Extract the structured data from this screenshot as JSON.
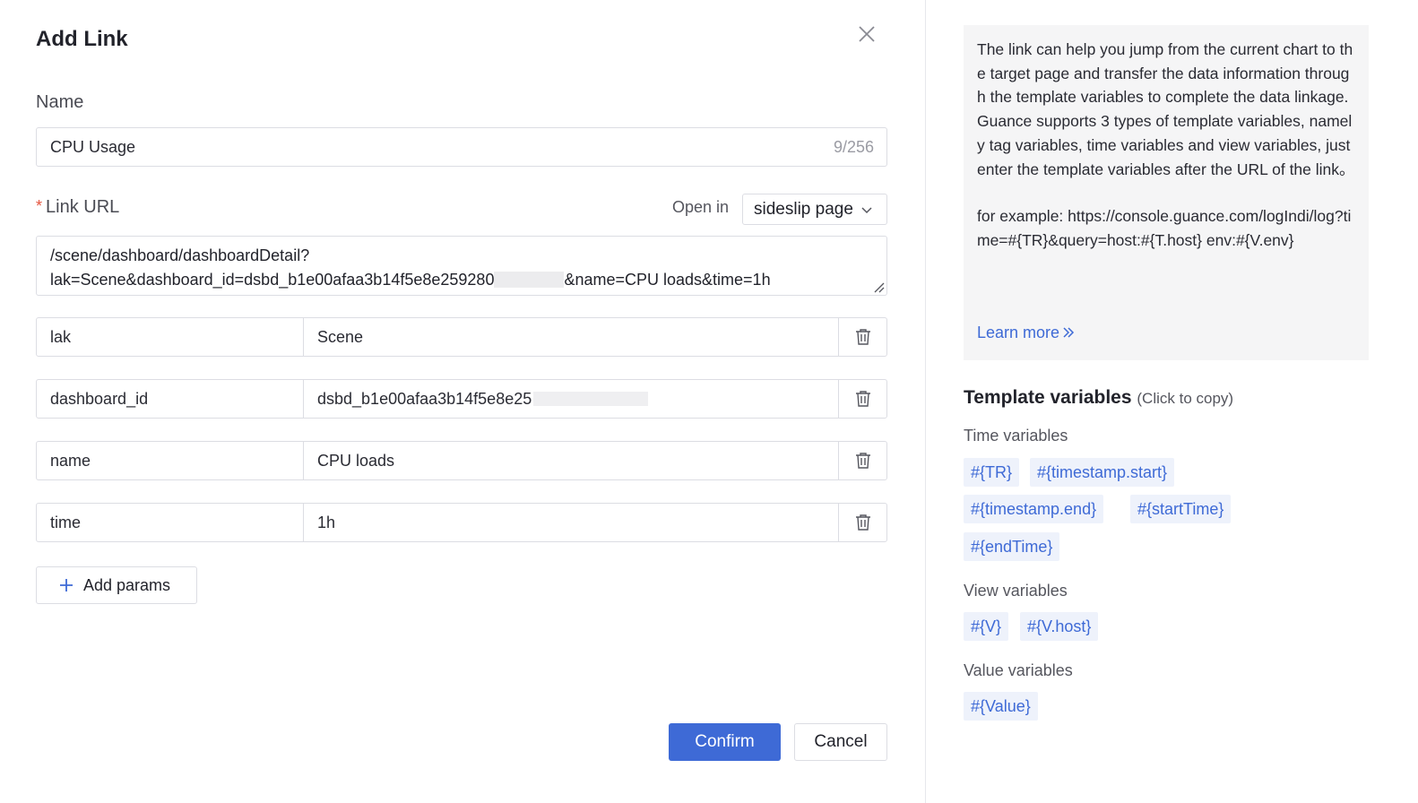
{
  "dialog": {
    "title": "Add Link",
    "close_icon": "close-icon"
  },
  "name_field": {
    "label": "Name",
    "value": "CPU Usage",
    "counter": "9/256"
  },
  "link_url": {
    "required_mark": "*",
    "label": "Link URL",
    "open_in_label": "Open in",
    "open_in_value": "sideslip page",
    "url_line1": "/scene/dashboard/dashboardDetail?",
    "url_line2_a": "lak=Scene&dashboard_id=dsbd_b1e00afaa3b14f5e8e259280",
    "url_line2_b": "&name=CPU loads&time=1h"
  },
  "params": [
    {
      "key": "lak",
      "value": "Scene"
    },
    {
      "key": "dashboard_id",
      "value": "dsbd_b1e00afaa3b14f5e8e25"
    },
    {
      "key": "name",
      "value": "CPU loads"
    },
    {
      "key": "time",
      "value": "1h"
    }
  ],
  "add_params_label": "Add params",
  "buttons": {
    "confirm": "Confirm",
    "cancel": "Cancel"
  },
  "help": {
    "description": "The link can help you jump from the current chart to the target page and transfer the data information through the template variables to complete the data linkage. Guance supports 3 types of template variables, namely tag variables, time variables and view variables, just enter the template variables after the URL of the link。",
    "example": " for example:  https://console.guance.com/logIndi/log?time=#{TR}&query=host:#{T.host} env:#{V.env}",
    "learn_more": "Learn more"
  },
  "template_variables": {
    "title": "Template variables",
    "hint": "(Click to copy)",
    "time_label": "Time variables",
    "time_tags": [
      "#{TR}",
      "#{timestamp.start}",
      "#{timestamp.end}",
      "#{startTime}",
      "#{endTime}"
    ],
    "view_label": "View variables",
    "view_tags": [
      "#{V}",
      "#{V.host}"
    ],
    "value_label": "Value variables",
    "value_tags": [
      "#{Value}"
    ]
  },
  "colors": {
    "accent": "#3e6ad6",
    "tag_bg": "#eef2fb",
    "required": "#e5533d"
  }
}
